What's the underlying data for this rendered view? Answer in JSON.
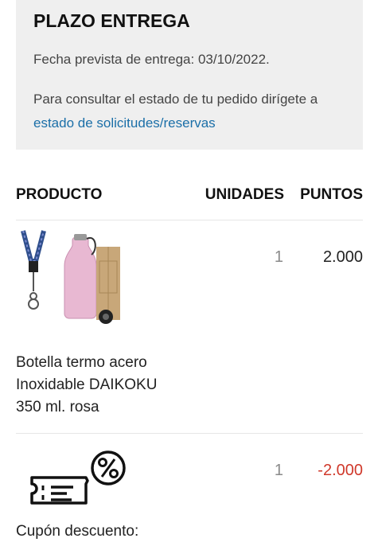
{
  "delivery": {
    "title": "PLAZO ENTREGA",
    "date_text": "Fecha prevista de entrega: 03/10/2022.",
    "info_text": "Para consultar el estado de tu pedido dirígete a",
    "info_link": "estado de solicitudes/reservas"
  },
  "table": {
    "col_product": "PRODUCTO",
    "col_units": "UNIDADES",
    "col_points": "PUNTOS"
  },
  "items": [
    {
      "name_line1": "Botella termo acero",
      "name_line2": "Inoxidable DAIKOKU",
      "name_line3": "350 ml. rosa",
      "units": "1",
      "points": "2.000",
      "icon": "thermo-bottle-image"
    },
    {
      "name_line1": "Cupón descuento:",
      "units": "1",
      "points": "-2.000",
      "icon": "discount-coupon-icon"
    }
  ],
  "colors": {
    "link": "#1b6fa8",
    "negative": "#d0392b",
    "panel": "#efefef"
  }
}
